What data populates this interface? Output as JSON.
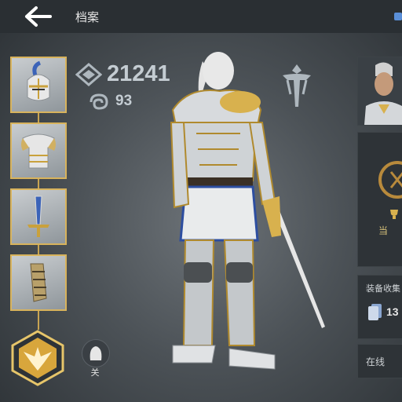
{
  "header": {
    "title": "档案"
  },
  "stats": {
    "power": "21241",
    "level": "93"
  },
  "toggle": {
    "label": "关"
  },
  "right_panel": {
    "rank_label": "当",
    "collection_label": "装备收集",
    "collection_count": "13",
    "online_label": "在线"
  },
  "colors": {
    "gold": "#d8b35c",
    "panel": "#2e3337",
    "stat_text": "#c4ccd2"
  }
}
